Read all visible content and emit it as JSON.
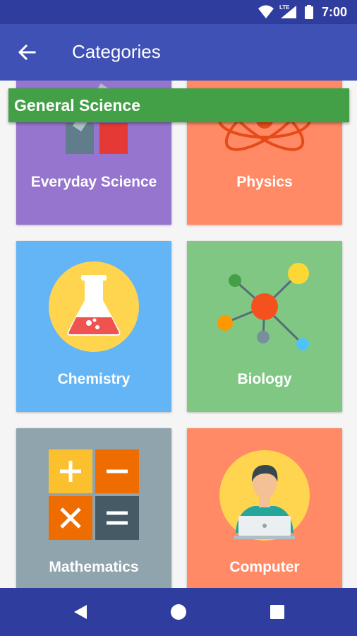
{
  "status_bar": {
    "time": "7:00",
    "network": "LTE"
  },
  "app_bar": {
    "title": "Categories",
    "back_icon": "arrow-left-icon"
  },
  "banner": {
    "label": "General Science"
  },
  "categories": [
    {
      "label": "Everyday Science",
      "color": "#9575cd",
      "icon": "everyday-science-icon"
    },
    {
      "label": "Physics",
      "color": "#ff8a65",
      "icon": "atom-icon"
    },
    {
      "label": "Chemistry",
      "color": "#64b5f6",
      "icon": "flask-icon"
    },
    {
      "label": "Biology",
      "color": "#81c784",
      "icon": "molecule-icon"
    },
    {
      "label": "Mathematics",
      "color": "#90a4ae",
      "icon": "calculator-icon"
    },
    {
      "label": "Computer",
      "color": "#ff8a65",
      "icon": "computer-user-icon"
    }
  ],
  "nav_bar": {
    "back": "nav-back-icon",
    "home": "nav-home-icon",
    "recents": "nav-recents-icon"
  },
  "colors": {
    "primary": "#3f51b5",
    "primary_dark": "#2f3e9e",
    "banner": "#43a047"
  }
}
